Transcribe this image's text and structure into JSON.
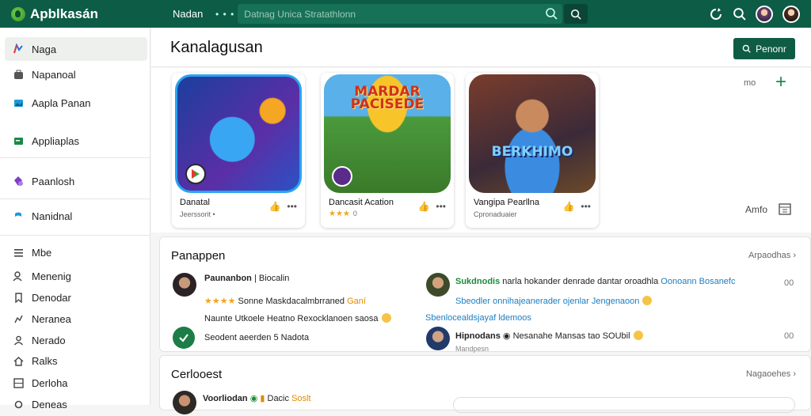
{
  "app": {
    "title": "Apblkasán"
  },
  "topbar": {
    "nav_label": "Nadan",
    "search_placeholder": "Datnag   Unica  Stratathlonn"
  },
  "sidebar": {
    "items": [
      {
        "label": "Naga",
        "icon": "puzzle-icon"
      },
      {
        "label": "Napanoal",
        "icon": "bag-icon"
      },
      {
        "label": "Aapla Panan",
        "icon": "gallery-icon"
      },
      {
        "label": "Appliaplas",
        "icon": "folder-icon"
      },
      {
        "label": "Paanlosh",
        "icon": "gem-icon"
      },
      {
        "label": "Nanidnal",
        "icon": "flag-icon"
      },
      {
        "label": "Mbe",
        "icon": "list-icon"
      },
      {
        "label": "Menenig",
        "icon": "people-icon"
      },
      {
        "label": "Denodar",
        "icon": "bookmark-icon"
      },
      {
        "label": "Neranea",
        "icon": "chart-icon"
      },
      {
        "label": "Nerado",
        "icon": "person-icon"
      },
      {
        "label": "Ralks",
        "icon": "home-icon"
      },
      {
        "label": "Derloha",
        "icon": "grid-icon"
      },
      {
        "label": "Deneas",
        "icon": "settings-icon"
      }
    ]
  },
  "main": {
    "title": "Kanalagusan",
    "new_button": "Penonr",
    "more_label": "mo",
    "amfo_label": "Amfo",
    "cards": [
      {
        "name": "Danatal",
        "sub": "Jeerssorit •",
        "art_text": ""
      },
      {
        "name": "Dancasit Acation",
        "stars": "★★★",
        "rating": "0",
        "art_text": "MARDAR PACISEDE"
      },
      {
        "name": "Vangipa Pearllna",
        "sub": "Cpronaduaier",
        "art_text": "BERKHIMO"
      }
    ]
  },
  "reviews": {
    "title": "Panappen",
    "link": "Arpaodhas",
    "left": [
      {
        "name": "Paunanbon",
        "tag": "| Biocalin",
        "stars": "★★★★",
        "line": "Sonne Maskdacalmbrraned",
        "highlight": "Ganí"
      },
      {
        "line": "Naunte Utkoele Heatno Rexocklanoen saosa"
      },
      {
        "line": "Seodent aeerden 5 Nadota"
      }
    ],
    "right": [
      {
        "name": "Sukdnodis",
        "line1": "narla hokander denrade dantar oroadhla",
        "link1": "Oonoann Bosanefc",
        "count": "00"
      },
      {
        "line": "Sbeodler onnihajeanerader ojenlar Jengenaoon"
      },
      {
        "line": "Sbenlocealdsjayaf ldemoos"
      },
      {
        "name": "Hipnodans",
        "line1": "Nesanahe Mansas tao SOUbil",
        "count": "00"
      },
      {
        "line": "Mandpesn"
      }
    ]
  },
  "comments": {
    "title": "Cerlooest",
    "link": "Nagaoehes",
    "name": "Voorliodan",
    "tag": "Dacic",
    "highlight": "Soslt"
  }
}
